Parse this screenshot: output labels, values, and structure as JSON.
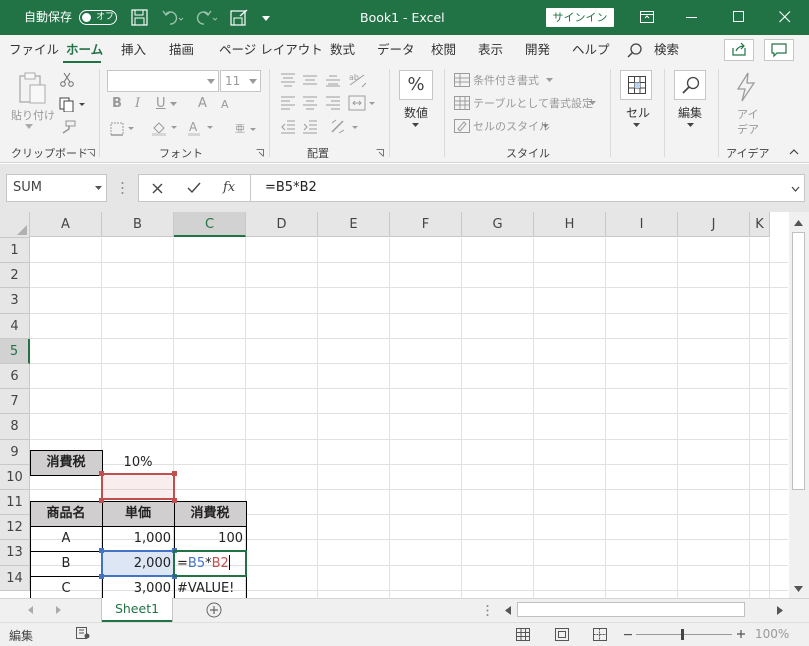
{
  "titlebar": {
    "autosave_label": "自動保存",
    "autosave_state": "オフ",
    "title": "Book1  -  Excel",
    "signin": "サインイン"
  },
  "menu": [
    "ファイル",
    "ホーム",
    "挿入",
    "描画",
    "ページ レイアウト",
    "数式",
    "データ",
    "校閲",
    "表示",
    "開発",
    "ヘルプ",
    "検索"
  ],
  "menu_active": "ホーム",
  "ribbon": {
    "clipboard": {
      "paste": "貼り付け",
      "group": "クリップボード"
    },
    "font": {
      "name": "",
      "size": "11",
      "group": "フォント",
      "bold": "B",
      "italic": "I",
      "underline": "U",
      "grow": "A",
      "shrink": "A"
    },
    "alignment": {
      "group": "配置"
    },
    "styles": {
      "conditional": "条件付き書式",
      "table": "テーブルとして書式設定",
      "cell_styles": "セルのスタイル",
      "group": "スタイル"
    },
    "number": {
      "symbol": "%",
      "label": "数値"
    },
    "cells": {
      "label": "セル"
    },
    "editing": {
      "label": "編集"
    },
    "ideas": {
      "label1": "アイ",
      "label2": "デア",
      "group": "アイデア"
    }
  },
  "formula_bar": {
    "name_box": "SUM",
    "formula": "=B5*B2"
  },
  "columns": [
    "A",
    "B",
    "C",
    "D",
    "E",
    "F",
    "G",
    "H",
    "I",
    "J",
    "K"
  ],
  "selected_column": "C",
  "rows": [
    "1",
    "2",
    "3",
    "4",
    "5",
    "6",
    "7",
    "8",
    "9",
    "10",
    "11",
    "12",
    "13",
    "14"
  ],
  "selected_row": "5",
  "cells": {
    "A1": "消費税",
    "B1": "10%",
    "A3": "商品名",
    "B3": "単価",
    "C3": "消費税",
    "A4": "A",
    "B4": "1,000",
    "C4": "100",
    "A5": "B",
    "B5": "2,000",
    "C5_prefix": "=",
    "C5_ref1": "B5",
    "C5_op": "*",
    "C5_ref2": "B2",
    "A6": "C",
    "B6": "3,000",
    "C6": "#VALUE!"
  },
  "colors": {
    "brand": "#217346",
    "ref1": "#4472c4",
    "ref2": "#c0504d",
    "header_fill": "#d0cece"
  },
  "sheets": [
    "Sheet1"
  ],
  "status": {
    "mode": "編集",
    "zoom": "100%"
  }
}
